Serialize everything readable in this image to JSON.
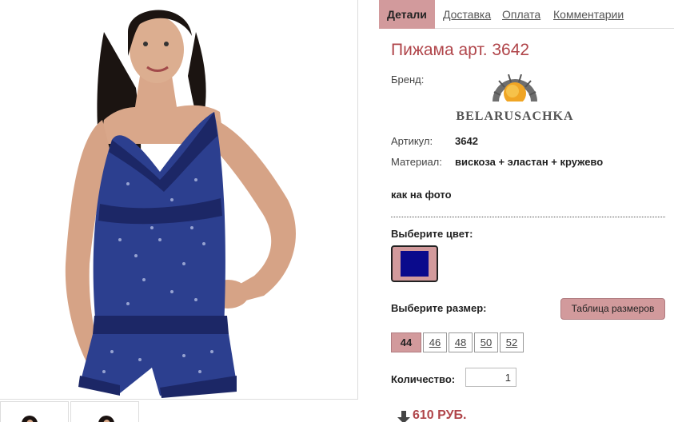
{
  "tabs": [
    {
      "label": "Детали"
    },
    {
      "label": "Доставка"
    },
    {
      "label": "Оплата"
    },
    {
      "label": "Комментарии"
    }
  ],
  "product": {
    "title": "Пижама арт. 3642",
    "brand_label": "Бренд:",
    "brand_logo_text": "BELARUSACHKA",
    "article_label": "Артикул:",
    "article_value": "3642",
    "material_label": "Материал:",
    "material_value": "вискоза + эластан + кружево",
    "note": "как на фото"
  },
  "color": {
    "label": "Выберите цвет:",
    "selected": "#0a0a8c"
  },
  "size": {
    "label": "Выберите размер:",
    "table_button": "Таблица размеров",
    "options": [
      "44",
      "46",
      "48",
      "50",
      "52"
    ],
    "selected": "44"
  },
  "quantity": {
    "label": "Количество:",
    "value": "1"
  },
  "price": {
    "text": "610 РУБ."
  },
  "colors": {
    "accent": "#d29a9c",
    "title": "#b0454a",
    "swatch": "#0a0a8c"
  }
}
